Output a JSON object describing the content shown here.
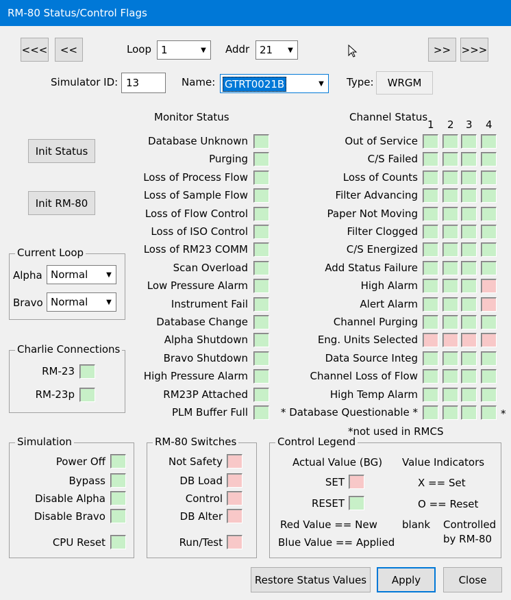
{
  "window": {
    "title": "RM-80 Status/Control Flags"
  },
  "nav": {
    "first": "<<<",
    "prev": "<<",
    "next": ">>",
    "last": ">>>"
  },
  "loop": {
    "label": "Loop",
    "value": "1"
  },
  "addr": {
    "label": "Addr",
    "value": "21"
  },
  "sim_id": {
    "label": "Simulator ID:",
    "value": "13"
  },
  "name": {
    "label": "Name:",
    "value": "GTRT0021B"
  },
  "type": {
    "label": "Type:",
    "value": "WRGM"
  },
  "buttons": {
    "init_status": "Init Status",
    "init_rm80": "Init RM-80",
    "restore": "Restore Status Values",
    "apply": "Apply",
    "close": "Close"
  },
  "current_loop": {
    "title": "Current Loop",
    "alpha_label": "Alpha",
    "alpha_value": "Normal",
    "bravo_label": "Bravo",
    "bravo_value": "Normal"
  },
  "charlie": {
    "title": "Charlie Connections",
    "items": [
      "RM-23",
      "RM-23p"
    ]
  },
  "monitor": {
    "title": "Monitor Status",
    "items": [
      "Database Unknown",
      "Purging",
      "Loss of Process Flow",
      "Loss of Sample Flow",
      "Loss of Flow Control",
      "Loss of ISO Control",
      "Loss of RM23 COMM",
      "Scan Overload",
      "Low Pressure Alarm",
      "Instrument Fail",
      "Database Change",
      "Alpha Shutdown",
      "Bravo Shutdown",
      "High Pressure Alarm",
      "RM23P Attached",
      "PLM Buffer Full"
    ]
  },
  "channel": {
    "title": "Channel Status",
    "columns": [
      "1",
      "2",
      "3",
      "4"
    ],
    "items": [
      {
        "label": "Out of Service",
        "flags": [
          "green",
          "green",
          "green",
          "green"
        ]
      },
      {
        "label": "C/S Failed",
        "flags": [
          "green",
          "green",
          "green",
          "green"
        ]
      },
      {
        "label": "Loss of Counts",
        "flags": [
          "green",
          "green",
          "green",
          "green"
        ]
      },
      {
        "label": "Filter Advancing",
        "flags": [
          "green",
          "green",
          "green",
          "green"
        ]
      },
      {
        "label": "Paper Not Moving",
        "flags": [
          "green",
          "green",
          "green",
          "green"
        ]
      },
      {
        "label": "Filter Clogged",
        "flags": [
          "green",
          "green",
          "green",
          "green"
        ]
      },
      {
        "label": "C/S Energized",
        "flags": [
          "green",
          "green",
          "green",
          "green"
        ]
      },
      {
        "label": "Add Status Failure",
        "flags": [
          "green",
          "green",
          "green",
          "green"
        ]
      },
      {
        "label": "High Alarm",
        "flags": [
          "green",
          "green",
          "green",
          "red"
        ]
      },
      {
        "label": "Alert Alarm",
        "flags": [
          "green",
          "green",
          "green",
          "red"
        ]
      },
      {
        "label": "Channel Purging",
        "flags": [
          "green",
          "green",
          "green",
          "green"
        ]
      },
      {
        "label": "Eng. Units Selected",
        "flags": [
          "red",
          "red",
          "red",
          "red"
        ]
      },
      {
        "label": "Data Source Integ",
        "flags": [
          "green",
          "green",
          "green",
          "green"
        ]
      },
      {
        "label": "Channel Loss of Flow",
        "flags": [
          "green",
          "green",
          "green",
          "green"
        ]
      },
      {
        "label": "High Temp Alarm",
        "flags": [
          "green",
          "green",
          "green",
          "green"
        ]
      },
      {
        "label": "* Database Questionable *",
        "flags": [
          "green",
          "green",
          "green",
          "green"
        ]
      }
    ],
    "trailing_star": "*",
    "footnote": "*not used in RMCS"
  },
  "simulation": {
    "title": "Simulation",
    "items": [
      "Power Off",
      "Bypass",
      "Disable Alpha",
      "Disable Bravo",
      "CPU Reset"
    ]
  },
  "switches": {
    "title": "RM-80 Switches",
    "items": [
      "Not Safety",
      "DB Load",
      "Control",
      "DB Alter",
      "Run/Test"
    ]
  },
  "legend": {
    "title": "Control Legend",
    "actual_value": "Actual Value (BG)",
    "value_indicators": "Value Indicators",
    "set": "SET",
    "reset": "RESET",
    "x_set": "X == Set",
    "o_reset": "O == Reset",
    "red_new": "Red Value == New",
    "blue_applied": "Blue Value == Applied",
    "blank": "blank",
    "controlled": "Controlled",
    "by_rm80": "by RM-80"
  },
  "colors": {
    "green_flag": "#c8f0c8",
    "red_flag": "#f8c8c8",
    "title_bar": "#0078d7"
  }
}
